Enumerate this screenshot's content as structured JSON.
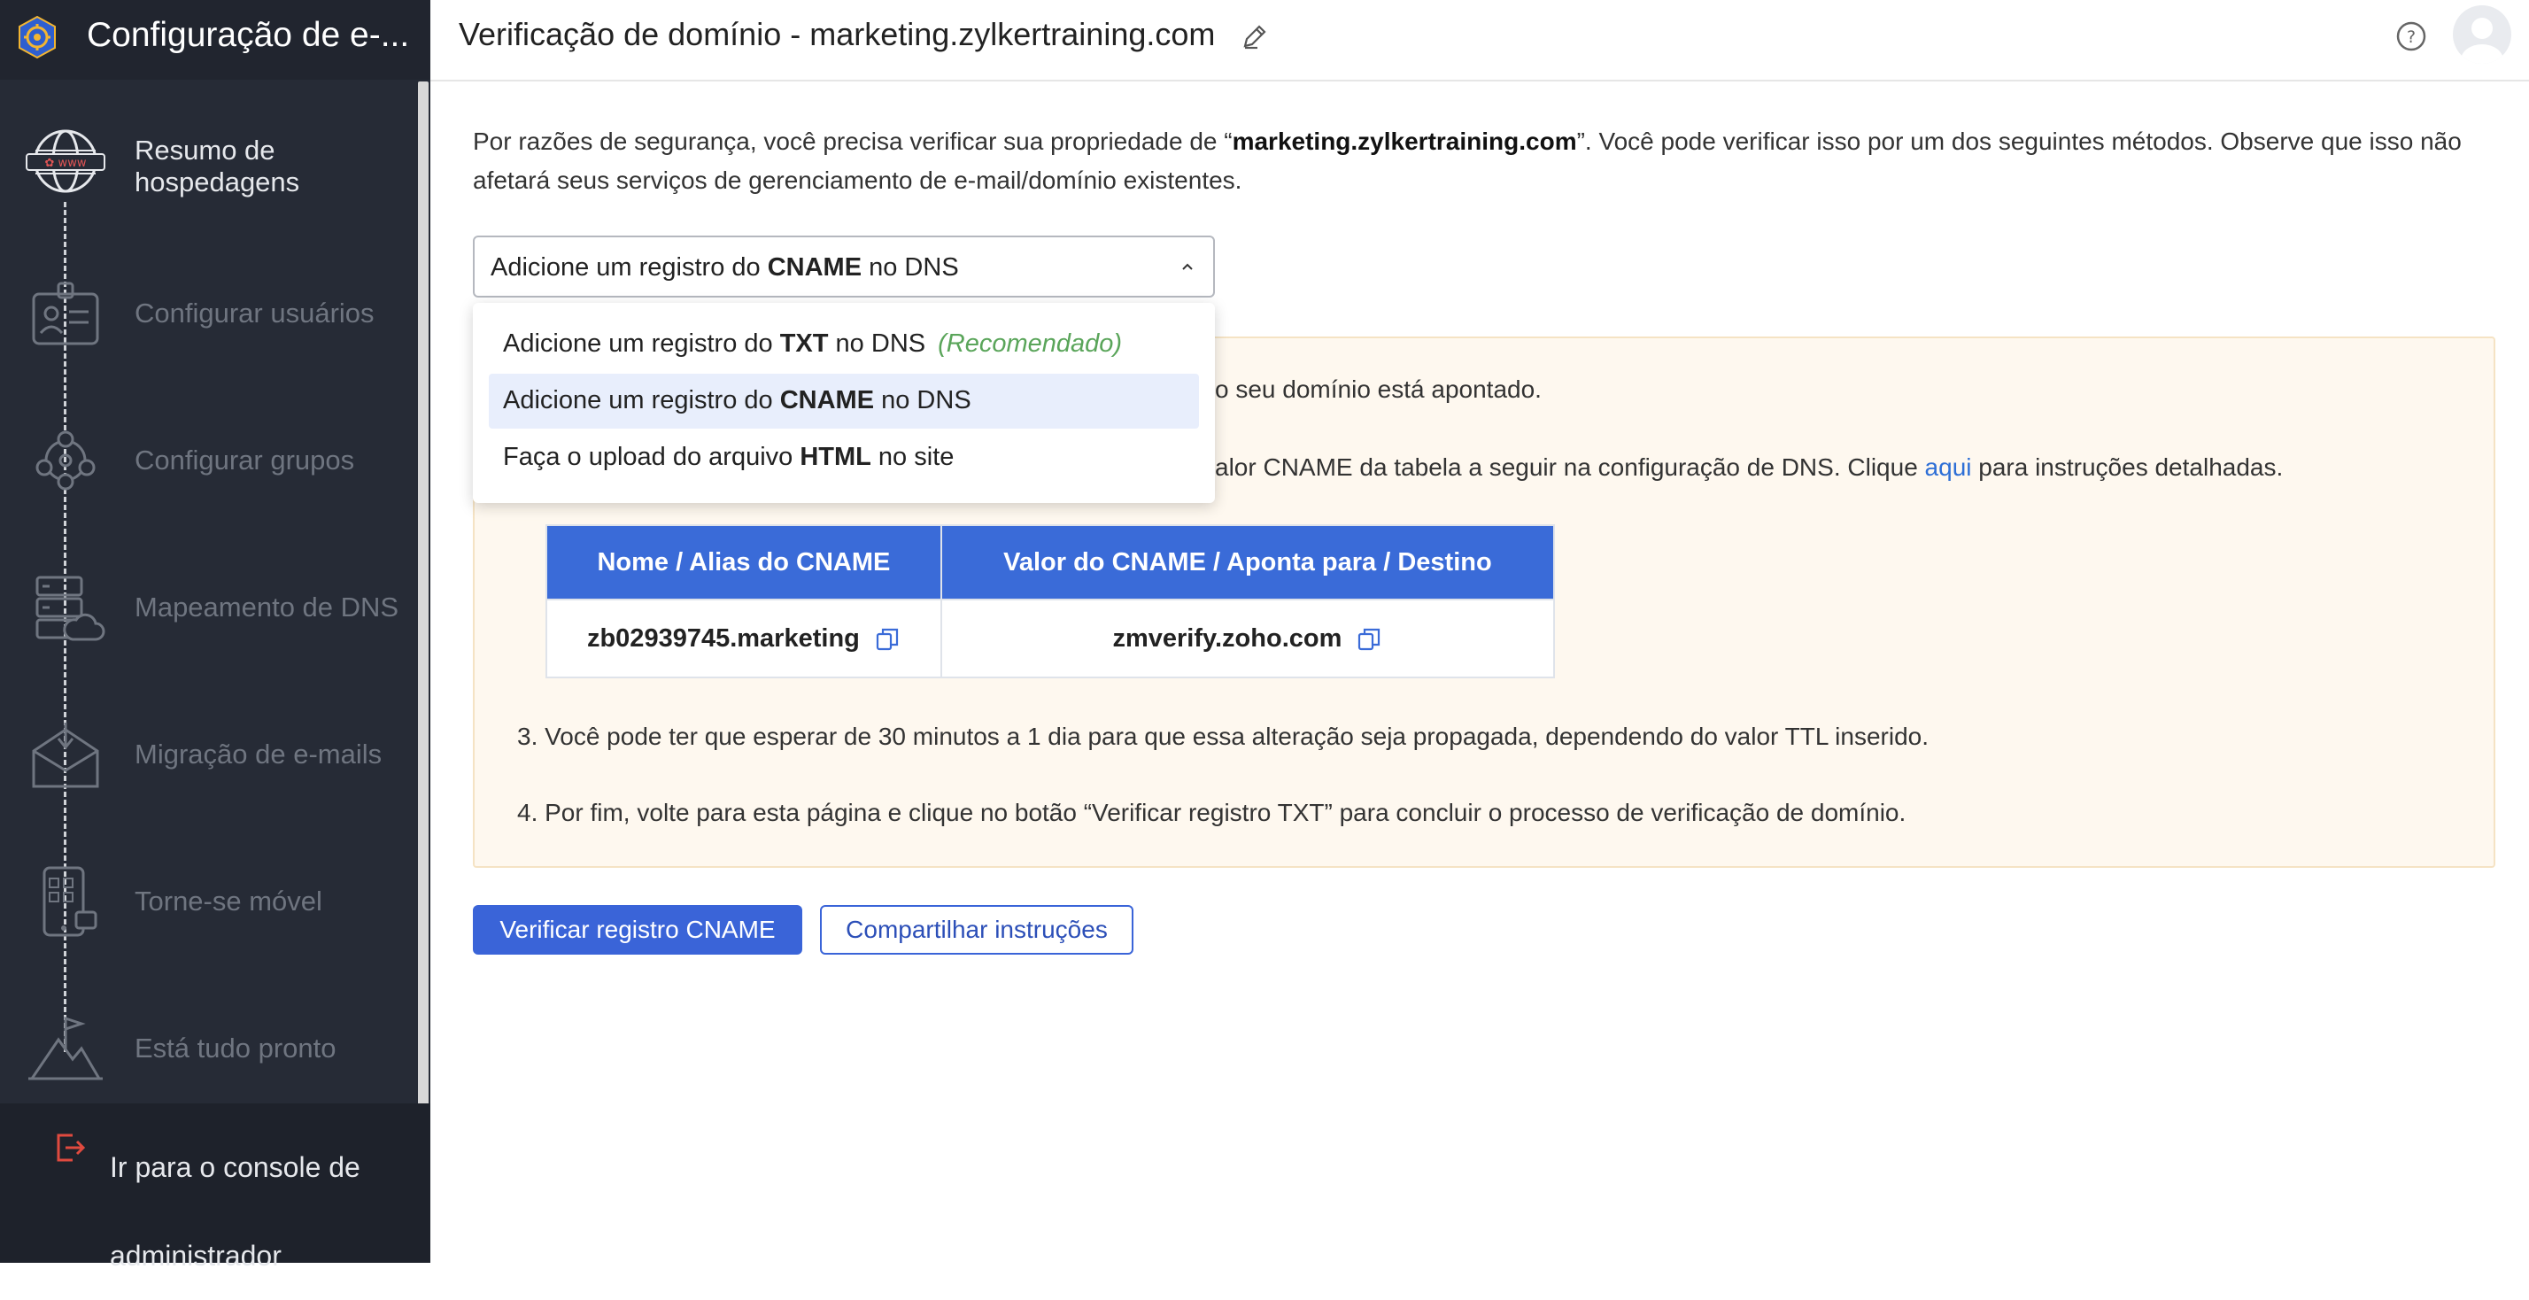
{
  "sidebar": {
    "title": "Configuração de e-...",
    "steps": [
      {
        "label": "Resumo de hospedagens",
        "icon": "globe-www-icon"
      },
      {
        "label": "Configurar usuários",
        "icon": "user-badge-icon"
      },
      {
        "label": "Configurar grupos",
        "icon": "group-network-icon"
      },
      {
        "label": "Mapeamento de DNS",
        "icon": "server-cloud-icon"
      },
      {
        "label": "Migração de e-mails",
        "icon": "mail-inbox-icon"
      },
      {
        "label": "Torne-se móvel",
        "icon": "mobile-apps-icon"
      },
      {
        "label": "Está tudo pronto",
        "icon": "mountain-flag-icon"
      }
    ],
    "footer_label": "Ir para o console de administrador"
  },
  "header": {
    "title": "Verificação de domínio - marketing.zylkertraining.com"
  },
  "intro": {
    "before": "Por razões de segurança, você precisa verificar sua propriedade de “",
    "domain": "marketing.zylkertraining.com",
    "after": "”. Você pode verificar isso por um dos seguintes métodos. Observe que isso não afetará seus serviços de gerenciamento de e-mail/domínio existentes."
  },
  "method_select": {
    "prefix": "Adicione um registro do ",
    "bold": "CNAME",
    "suffix": " no DNS"
  },
  "dropdown": {
    "options": [
      {
        "prefix": "Adicione um registro do ",
        "bold": "TXT",
        "suffix": " no DNS",
        "tag": "(Recomendado)"
      },
      {
        "prefix": "Adicione um registro do ",
        "bold": "CNAME",
        "suffix": " no DNS",
        "tag": ""
      },
      {
        "prefix": "Faça o upload do arquivo ",
        "bold": "HTML",
        "suffix": " no site",
        "tag": ""
      }
    ],
    "selected_index": 1
  },
  "instructions": {
    "step1_visible": "o seu domínio está apontado.",
    "step2_visible": "alor CNAME da tabela a seguir na configuração de DNS. Clique ",
    "step2_link": "aqui",
    "step2_end": " para instruções detalhadas.",
    "step3": "3. Você pode ter que esperar de 30 minutos a 1 dia para que essa alteração seja propagada, dependendo do valor TTL inserido.",
    "step4": "4. Por fim, volte para esta página e clique no botão “Verificar registro TXT” para concluir o processo de verificação de domínio."
  },
  "table": {
    "headers": [
      "Nome / Alias do CNAME",
      "Valor do CNAME / Aponta para / Destino"
    ],
    "row": [
      "zb02939745.marketing",
      "zmverify.zoho.com"
    ]
  },
  "buttons": {
    "verify": "Verificar registro CNAME",
    "share": "Compartilhar instruções"
  },
  "colors": {
    "sidebar_bg": "#262b36",
    "accent": "#3a64d8",
    "table_header": "#3a6bd8",
    "panel_bg": "#fef8ef",
    "recommended": "#5aa55a"
  }
}
